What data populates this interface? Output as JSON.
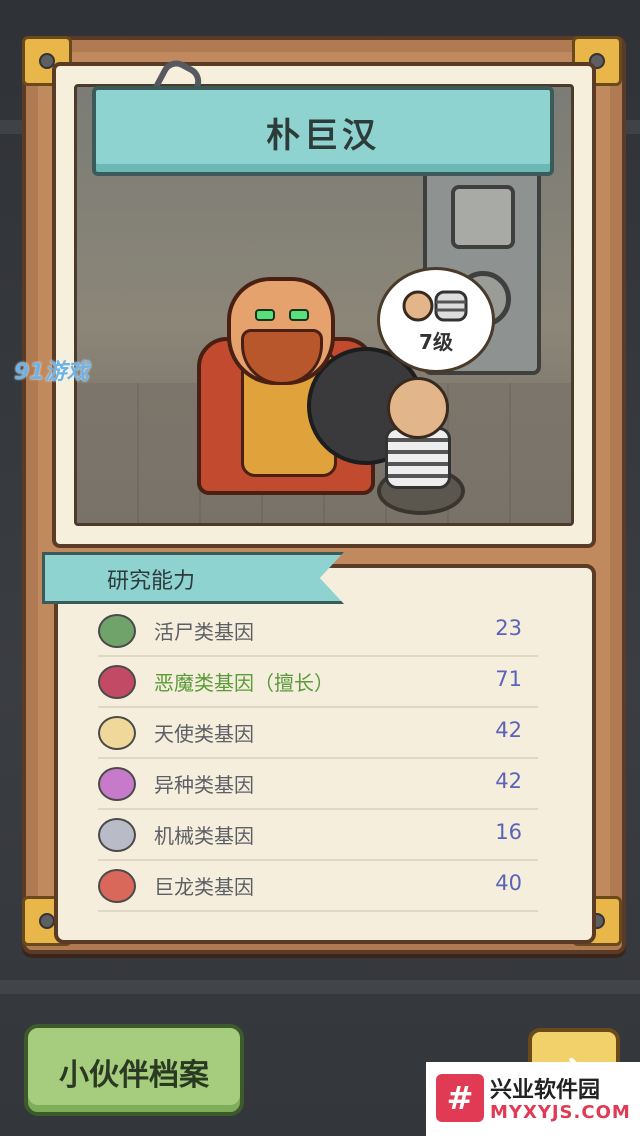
{
  "character": {
    "name": "朴巨汉",
    "level_text": "7级"
  },
  "research": {
    "tab_label": "研究能力",
    "genes": [
      {
        "name": "活尸类基因",
        "value": "23",
        "icon": "zombie-icon",
        "color": "#6fa36a",
        "specialty": false
      },
      {
        "name": "恶魔类基因（擅长）",
        "value": "71",
        "icon": "demon-icon",
        "color": "#c34a64",
        "specialty": true
      },
      {
        "name": "天使类基因",
        "value": "42",
        "icon": "angel-icon",
        "color": "#f0d79a",
        "specialty": false
      },
      {
        "name": "异种类基因",
        "value": "42",
        "icon": "alien-icon",
        "color": "#c77ac9",
        "specialty": false
      },
      {
        "name": "机械类基因",
        "value": "16",
        "icon": "robot-icon",
        "color": "#b9bcc6",
        "specialty": false
      },
      {
        "name": "巨龙类基因",
        "value": "40",
        "icon": "dragon-icon",
        "color": "#d9675a",
        "specialty": false
      }
    ]
  },
  "bottom": {
    "archive_label": "小伙伴档案",
    "next_icon": "arrow-right-icon"
  },
  "watermarks": {
    "left": "91游戏",
    "site_name": "兴业软件园",
    "site_url": "MYXYJS.COM"
  }
}
